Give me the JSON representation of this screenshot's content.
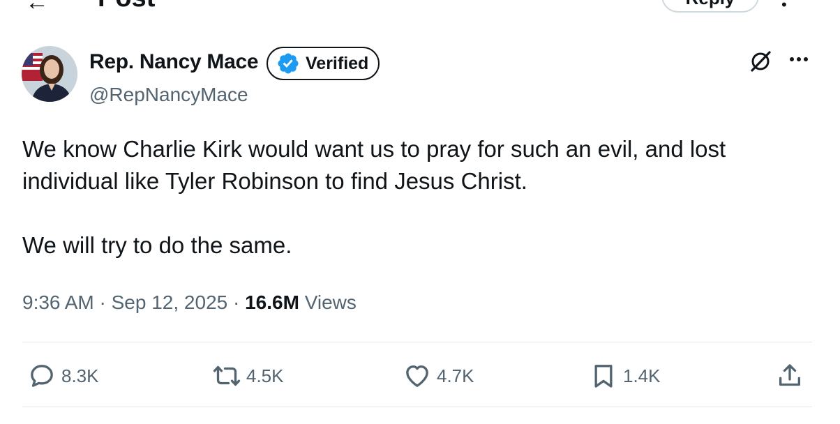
{
  "header": {
    "title": "Post",
    "reply_label": "Reply"
  },
  "author": {
    "name": "Rep. Nancy Mace",
    "handle": "@RepNancyMace",
    "verified_label": "Verified"
  },
  "tweet": {
    "paragraphs": [
      "We know Charlie Kirk would want us to pray for such an evil, and lost individual like Tyler Robinson to find Jesus Christ.",
      "We will try to do the same."
    ],
    "time": "9:36 AM",
    "date": "Sep 12, 2025",
    "views_count": "16.6M",
    "views_label": "Views"
  },
  "actions": {
    "replies": "8.3K",
    "reposts": "4.5K",
    "likes": "4.7K",
    "bookmarks": "1.4K"
  },
  "icons": {
    "back": "back-arrow-icon",
    "verified": "verified-badge-icon",
    "grok": "grok-icon",
    "more": "more-icon",
    "reply": "reply-icon",
    "repost": "repost-icon",
    "like": "heart-icon",
    "bookmark": "bookmark-icon",
    "share": "share-icon"
  },
  "colors": {
    "text": "#0f1419",
    "muted": "#536471",
    "verified_blue": "#1d9bf0",
    "border": "#cfd9de"
  }
}
